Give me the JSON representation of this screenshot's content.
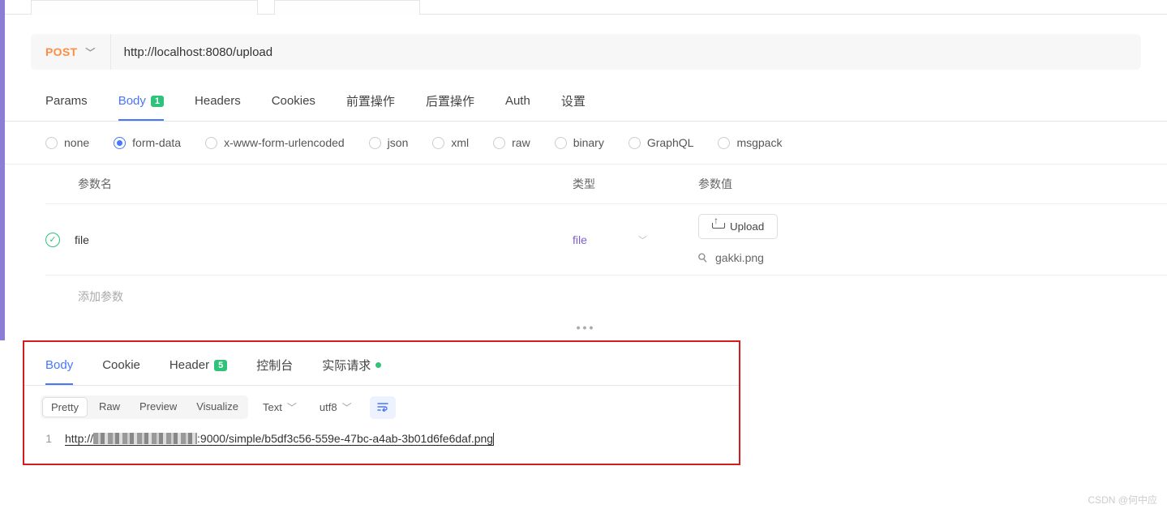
{
  "request": {
    "method": "POST",
    "url": "http://localhost:8080/upload"
  },
  "tabs": {
    "params": "Params",
    "body": "Body",
    "body_badge": "1",
    "headers": "Headers",
    "cookies": "Cookies",
    "pre": "前置操作",
    "post": "后置操作",
    "auth": "Auth",
    "settings": "设置"
  },
  "body_types": {
    "none": "none",
    "form_data": "form-data",
    "urlencoded": "x-www-form-urlencoded",
    "json": "json",
    "xml": "xml",
    "raw": "raw",
    "binary": "binary",
    "graphql": "GraphQL",
    "msgpack": "msgpack"
  },
  "params_table": {
    "head_name": "参数名",
    "head_type": "类型",
    "head_value": "参数值",
    "row1_name": "file",
    "row1_type": "file",
    "upload_btn": "Upload",
    "attachment": "gakki.png",
    "add_param": "添加参数"
  },
  "response_tabs": {
    "body": "Body",
    "cookie": "Cookie",
    "header": "Header",
    "header_badge": "5",
    "console": "控制台",
    "actual": "实际请求"
  },
  "resp_toolbar": {
    "pretty": "Pretty",
    "raw": "Raw",
    "preview": "Preview",
    "visualize": "Visualize",
    "format": "Text",
    "encoding": "utf8"
  },
  "response_body": {
    "line_no": "1",
    "prefix": "http://",
    "suffix": ":9000/simple/b5df3c56-559e-47bc-a4ab-3b01d6fe6daf.png"
  },
  "watermark": "CSDN @何中应"
}
